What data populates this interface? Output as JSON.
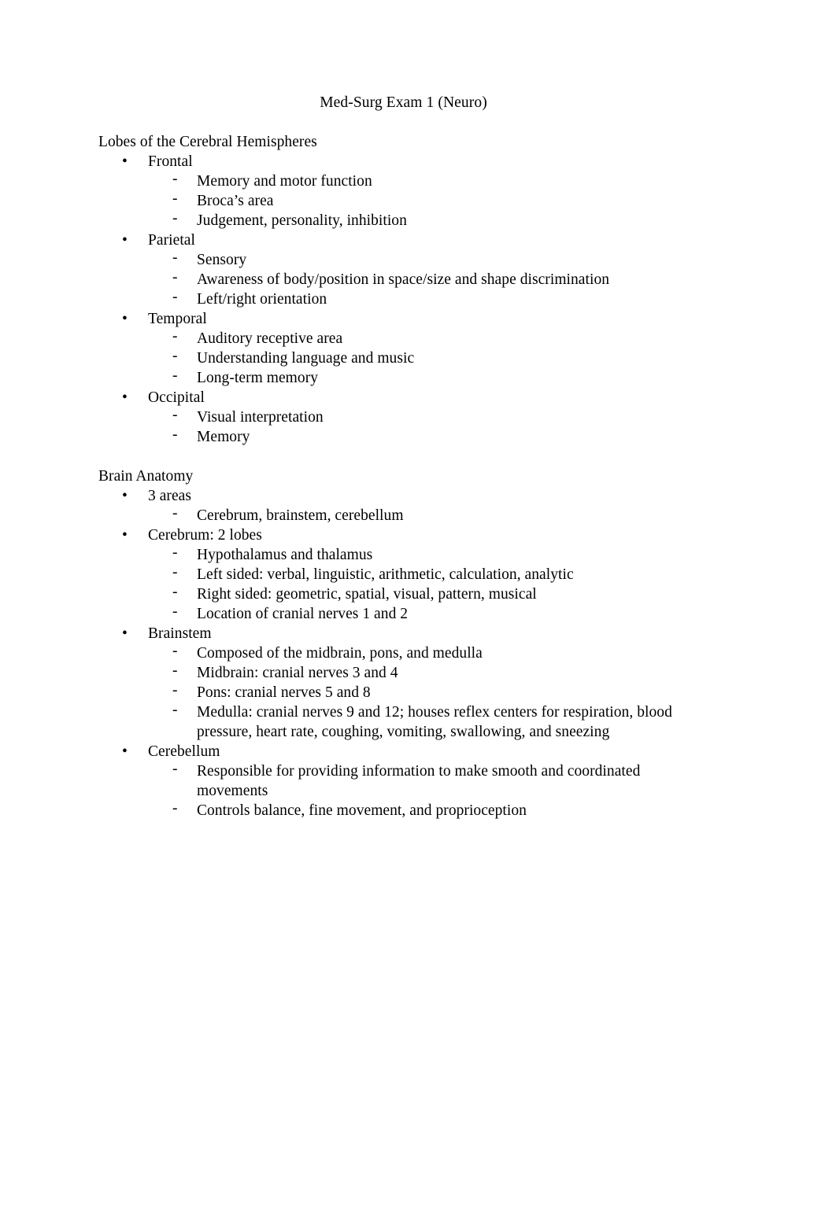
{
  "document": {
    "title": "Med-Surg Exam 1 (Neuro)",
    "bullet_level1_glyph": "•",
    "bullet_level2_glyph": "‐",
    "text_color": "#000000",
    "background_color": "#ffffff",
    "sections": [
      {
        "heading": "Lobes of the Cerebral Hemispheres",
        "items": [
          {
            "label": "Frontal",
            "subitems": [
              "Memory and motor function",
              "Broca’s area",
              "Judgement, personality, inhibition"
            ]
          },
          {
            "label": "Parietal",
            "subitems": [
              "Sensory",
              "Awareness of body/position in space/size and shape discrimination",
              "Left/right orientation"
            ]
          },
          {
            "label": "Temporal",
            "subitems": [
              "Auditory receptive area",
              "Understanding language and music",
              "Long-term memory"
            ]
          },
          {
            "label": "Occipital",
            "subitems": [
              "Visual interpretation",
              "Memory"
            ]
          }
        ]
      },
      {
        "heading": "Brain Anatomy",
        "items": [
          {
            "label": "3 areas",
            "subitems": [
              "Cerebrum, brainstem, cerebellum"
            ]
          },
          {
            "label": "Cerebrum: 2 lobes",
            "subitems": [
              "Hypothalamus and thalamus",
              "Left sided: verbal, linguistic, arithmetic, calculation, analytic",
              "Right sided: geometric, spatial, visual, pattern, musical",
              "Location of cranial nerves 1 and 2"
            ]
          },
          {
            "label": "Brainstem",
            "subitems": [
              "Composed of the midbrain, pons, and medulla",
              "Midbrain: cranial nerves 3 and 4",
              "Pons: cranial nerves 5 and 8",
              "Medulla: cranial nerves 9 and 12; houses reflex centers for respiration, blood pressure, heart rate, coughing, vomiting, swallowing, and sneezing"
            ]
          },
          {
            "label": "Cerebellum",
            "subitems": [
              "Responsible for providing information to make smooth and coordinated movements",
              "Controls balance, fine movement, and proprioception"
            ]
          }
        ]
      }
    ]
  }
}
